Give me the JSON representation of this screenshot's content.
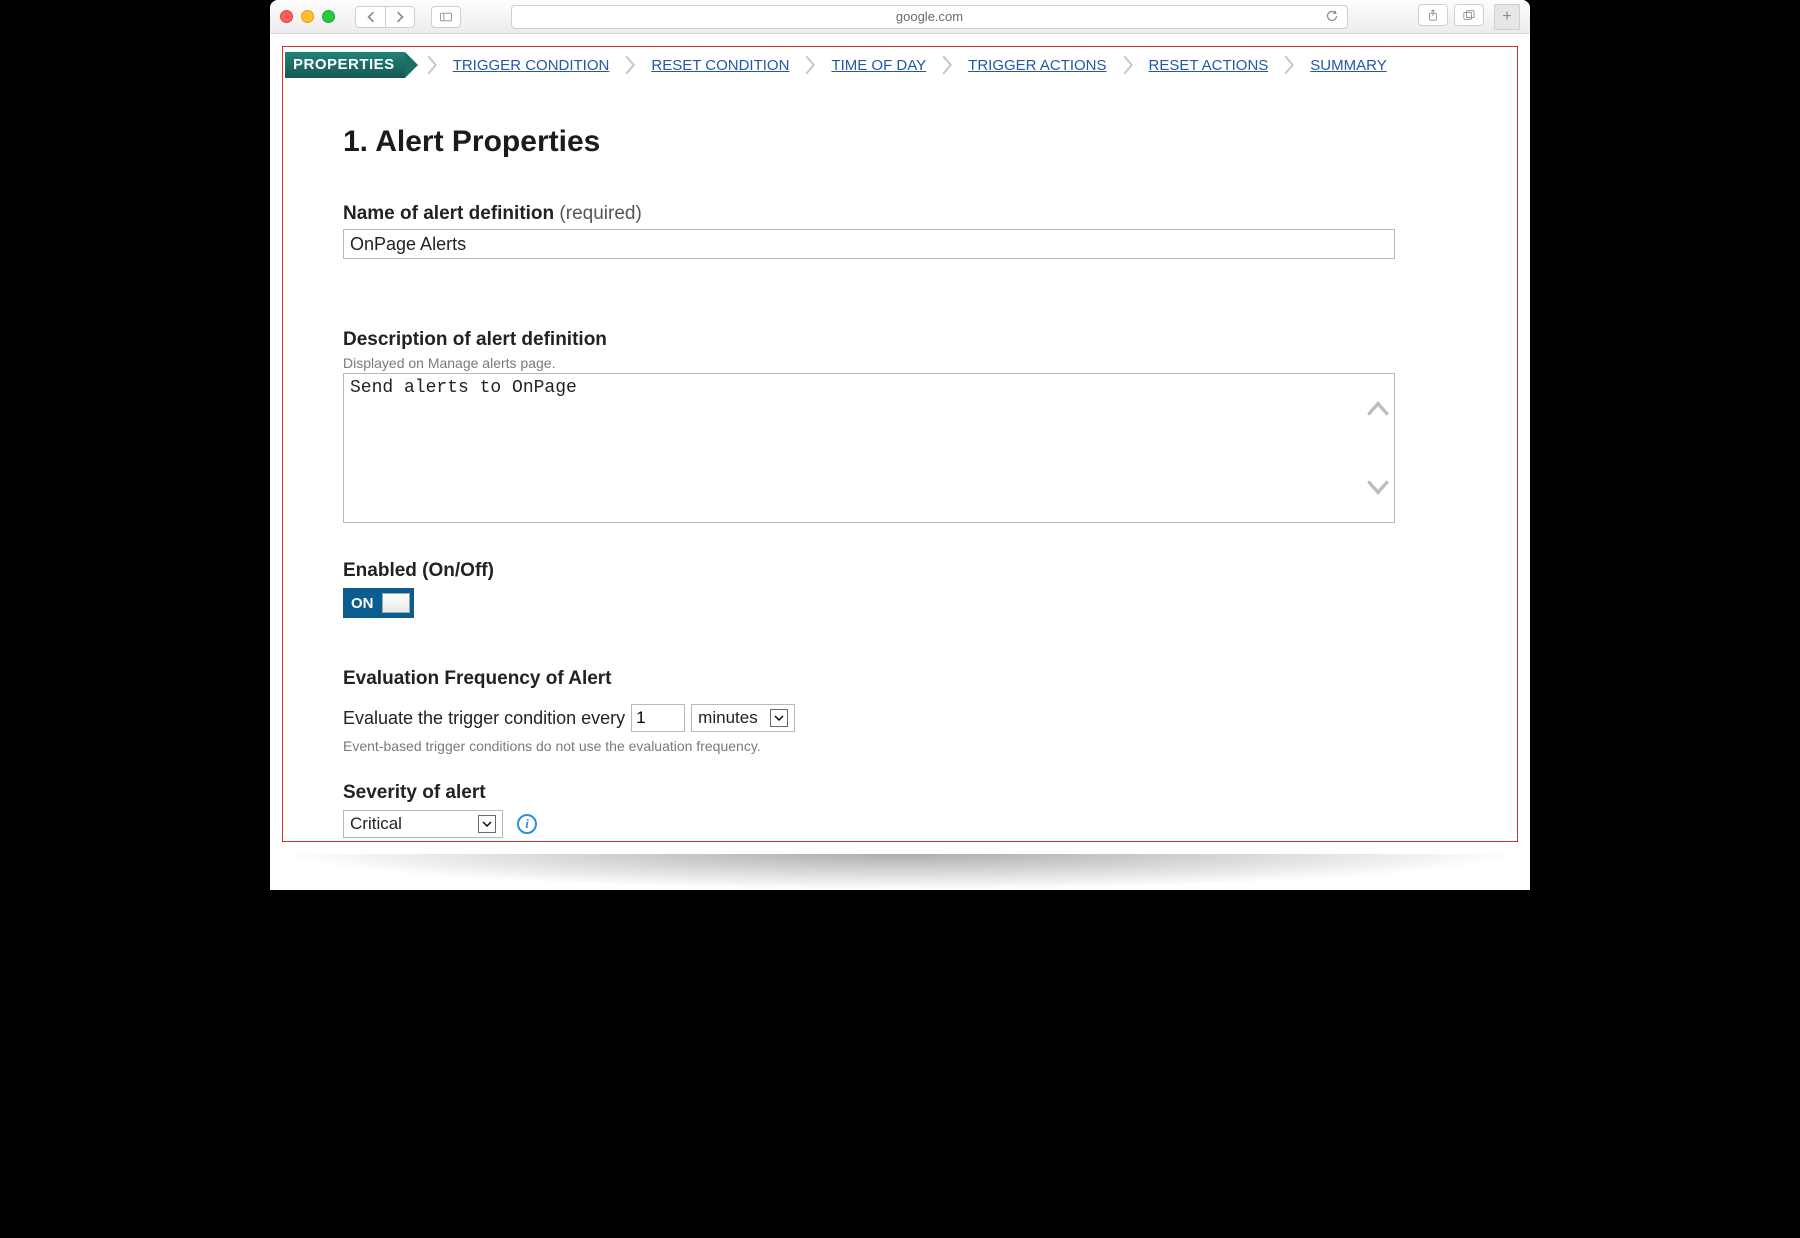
{
  "browser": {
    "url_display": "google.com"
  },
  "wizard": {
    "active": "PROPERTIES",
    "steps": [
      "TRIGGER CONDITION",
      "RESET CONDITION",
      "TIME OF DAY",
      "TRIGGER ACTIONS",
      "RESET ACTIONS",
      "SUMMARY"
    ]
  },
  "page": {
    "heading": "1. Alert Properties"
  },
  "name_field": {
    "label": "Name of alert definition",
    "required_text": "(required)",
    "value": "OnPage Alerts"
  },
  "description_field": {
    "label": "Description of alert definition",
    "help": "Displayed on Manage alerts page.",
    "value": "Send alerts to OnPage"
  },
  "enabled_field": {
    "label": "Enabled (On/Off)",
    "state_text": "ON",
    "state": true
  },
  "frequency_field": {
    "section_label": "Evaluation Frequency of Alert",
    "sentence_prefix": "Evaluate the trigger condition every",
    "interval_value": "1",
    "unit_selected": "minutes",
    "help": "Event-based trigger conditions do not use the evaluation frequency."
  },
  "severity_field": {
    "label": "Severity of alert",
    "selected": "Critical"
  }
}
